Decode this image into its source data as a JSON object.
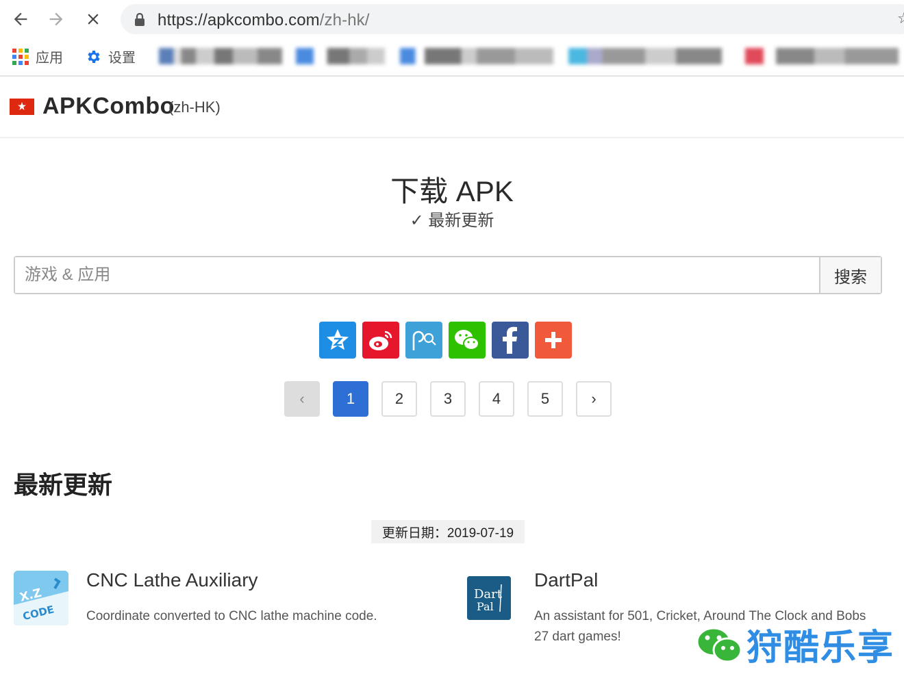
{
  "browser": {
    "url_host": "https://apkcombo.com",
    "url_path": "/zh-hk/",
    "bookmarks": [
      {
        "label": "应用",
        "icon": "apps-grid-icon"
      },
      {
        "label": "设置",
        "icon": "gear-icon"
      }
    ]
  },
  "header": {
    "brand": "APKCombo",
    "locale": "(zh-HK)",
    "flag": "hong-kong-flag-icon"
  },
  "hero": {
    "title": "下载 APK",
    "subtitle": "✓ 最新更新"
  },
  "search": {
    "placeholder": "游戏 & 应用",
    "button_label": "搜索"
  },
  "share": [
    {
      "name": "qzone",
      "icon": "qzone-star-icon",
      "color": "#1e8ee5"
    },
    {
      "name": "weibo",
      "icon": "weibo-icon",
      "color": "#e6162d"
    },
    {
      "name": "tencent-weibo",
      "icon": "tencent-weibo-icon",
      "color": "#3ea1d8"
    },
    {
      "name": "wechat",
      "icon": "wechat-icon",
      "color": "#2dc100"
    },
    {
      "name": "facebook",
      "icon": "facebook-icon",
      "color": "#3b5998"
    },
    {
      "name": "more",
      "icon": "plus-icon",
      "color": "#f0593a"
    }
  ],
  "pagination": {
    "prev": "‹",
    "pages": [
      "1",
      "2",
      "3",
      "4",
      "5"
    ],
    "current": "1",
    "next": "›"
  },
  "latest": {
    "title": "最新更新",
    "date_label": "更新日期：2019-07-19",
    "apps": [
      {
        "name": "CNC Lathe Auxiliary",
        "description": "Coordinate converted to CNC lathe machine code.",
        "icon_text_1": "X.Z",
        "icon_text_2": "CODE"
      },
      {
        "name": "DartPal",
        "description": "An assistant for 501, Cricket, Around The Clock and Bobs 27 dart games!",
        "icon_text_1": "Dart",
        "icon_text_2": "Pal"
      }
    ]
  },
  "watermark": {
    "text": "狩酷乐享"
  }
}
